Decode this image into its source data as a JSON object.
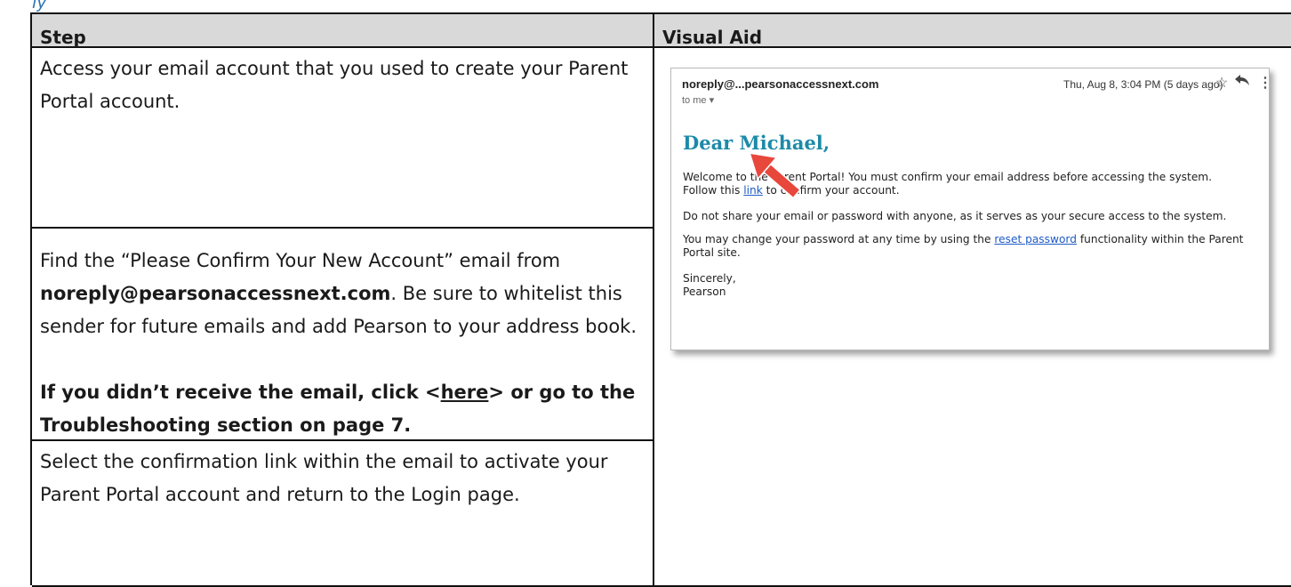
{
  "header_fragment": "ly",
  "table": {
    "header_step": "Step",
    "header_visual": "Visual Aid",
    "row1": "Access your email account that you used to create your Parent Portal account.",
    "row2": {
      "p1_before": "Find the “Please Confirm Your New Account” email from ",
      "p1_bold": "noreply@pearsonaccessnext.com",
      "p1_after": ". Be sure to whitelist this sender for future emails and add Pearson to your address book.",
      "p2_before": "If you didn’t receive the email, click <",
      "p2_link": "here",
      "p2_after": "> or go to the Troubleshooting section on page 7."
    },
    "row3": "Select the confirmation link within the email to activate your Parent Portal account and return to the Login page."
  },
  "email": {
    "from": "noreply@...pearsonaccessnext.com",
    "to": "to me ▾",
    "date": "Thu, Aug 8, 3:04 PM (5 days ago)",
    "icons": [
      "star-icon",
      "reply-icon",
      "more-icon"
    ],
    "greeting": "Dear Michael,",
    "line1": "Welcome to the Parent Portal! You must confirm your email address before accessing the system.",
    "line2_before": "Follow this ",
    "line2_link": "link",
    "line2_after": " to confirm your account.",
    "line3": "Do not share your email or password with anyone, as it serves as your secure access to the system.",
    "line4_before": "You may change your password at any time by using the ",
    "line4_link": "reset password",
    "line4_after": " functionality within the Parent Portal site.",
    "sign1": "Sincerely,",
    "sign2": "Pearson"
  },
  "colors": {
    "link": "#1f5bc6",
    "greeting": "#1c8aa8",
    "arrow": "#e8473c",
    "header_bg": "#d9d9d9"
  }
}
